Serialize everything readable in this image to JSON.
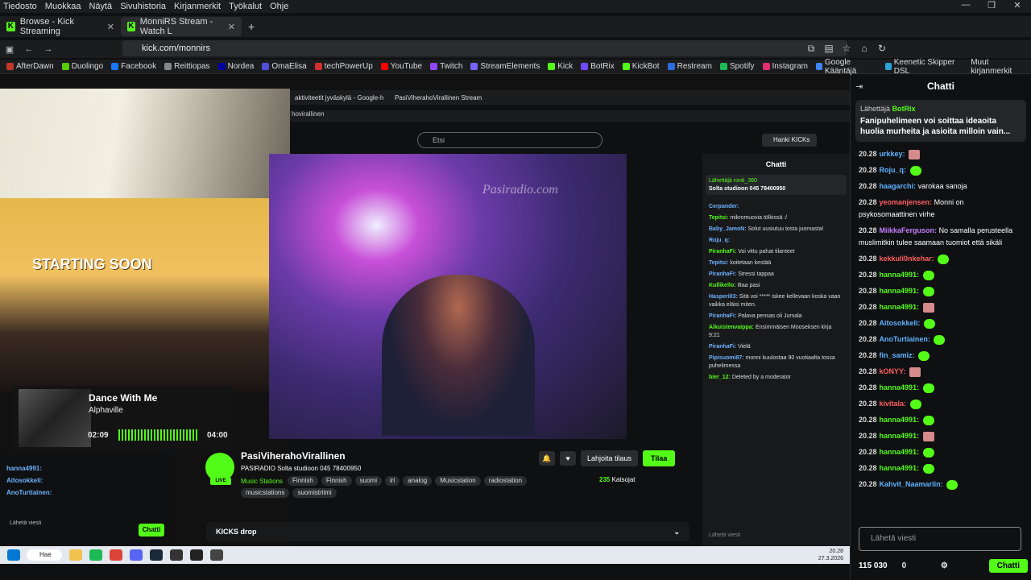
{
  "menubar": [
    "Tiedosto",
    "Muokkaa",
    "Näytä",
    "Sivuhistoria",
    "Kirjanmerkit",
    "Työkalut",
    "Ohje"
  ],
  "tabs": [
    {
      "label": "Browse - Kick Streaming"
    },
    {
      "label": "MonniRS Stream - Watch L"
    }
  ],
  "url": "kick.com/monnirs",
  "bookmarks": [
    {
      "label": "AfterDawn",
      "color": "#c0392b"
    },
    {
      "label": "Duolingo",
      "color": "#58cc02"
    },
    {
      "label": "Facebook",
      "color": "#1877f2"
    },
    {
      "label": "Reittiopas",
      "color": "#888888"
    },
    {
      "label": "Nordea",
      "color": "#0000a0"
    },
    {
      "label": "OmaElisa",
      "color": "#4f4fd9"
    },
    {
      "label": "techPowerUp",
      "color": "#d32f2f"
    },
    {
      "label": "YouTube",
      "color": "#ff0000"
    },
    {
      "label": "Twitch",
      "color": "#9146ff"
    },
    {
      "label": "StreamElements",
      "color": "#7b61ff"
    },
    {
      "label": "Kick",
      "color": "#53fc18"
    },
    {
      "label": "BotRix",
      "color": "#6d4aff"
    },
    {
      "label": "KickBot",
      "color": "#53fc18"
    },
    {
      "label": "Restream",
      "color": "#2d6cdf"
    },
    {
      "label": "Spotify",
      "color": "#1db954"
    },
    {
      "label": "Instagram",
      "color": "#e1306c"
    },
    {
      "label": "Google Kääntäjä",
      "color": "#4285f4"
    },
    {
      "label": "Keenetic Skipper DSL",
      "color": "#2aa3d8"
    }
  ],
  "bookmarks_other": "Muut kirjanmerkit",
  "overlay": {
    "starting_soon": "STARTING SOON"
  },
  "inner": {
    "tab1": "aktiviteetit jyväskylä - Google-h",
    "tab2": "PasiViherahoVirallinen Stream",
    "url": "hovirallinen",
    "search": "Etsi",
    "kicks": "Hanki KICKs",
    "watermark": "Pasiradio.com",
    "chat_title": "Chatti",
    "pin_user": "Lähettäjä  ronti_360",
    "pin_text": "Solta studioon 045 78400950",
    "messages": [
      {
        "user": "Cerpander:",
        "text": ""
      },
      {
        "user": "Tepitsi:",
        "text": "mikromuovia tölkissä :/"
      },
      {
        "user": "Baby_JamoN:",
        "text": "Solut uusiutuu tosta juomasta!"
      },
      {
        "user": "Roju_q:",
        "text": ""
      },
      {
        "user": "PiranhaFi:",
        "text": "Voi vittu pahat tilanteet"
      },
      {
        "user": "Tepitsi:",
        "text": "koitetaan kestää"
      },
      {
        "user": "PiranhaFi:",
        "text": "Stressi tappaa"
      },
      {
        "user": "Kullikello:",
        "text": "Iltaa pasi"
      },
      {
        "user": "Hasperi03:",
        "text": "Sitä voi ***** iskee kellevaan koska vaan vaikka eläisi miten."
      },
      {
        "user": "PiranhaFi:",
        "text": "Palava pensas oli Jumala"
      },
      {
        "user": "Aikuistenvaippa:",
        "text": "Ensimmäisen Mooseksen kirja 9:21"
      },
      {
        "user": "PiranhaFi:",
        "text": "Vielä"
      },
      {
        "user": "Pipisuomi87:",
        "text": "monni kuulostaa 90 vuotiaalta tossa puhelimessa"
      },
      {
        "user": "bier_12:",
        "text": "Deleted by a moderator"
      }
    ],
    "input": "Lähetä viesti"
  },
  "stream": {
    "name": "PasiViherahoVirallinen",
    "title": "PASIRADIO Solta studioon 045 78400950",
    "category": "Music Stations",
    "tags": [
      "Finnish",
      "Finnish",
      "suomi",
      "irl",
      "analog",
      "Musicstation",
      "radiostation",
      "musicstations",
      "suomistriimi"
    ],
    "live": "LIVE",
    "gift": "Lahjoita tilaus",
    "subscribe": "Tilaa",
    "viewers": "235",
    "viewers_label": "Katsojat",
    "kicks_drop": "KICKS drop"
  },
  "music": {
    "song": "Dance With Me",
    "artist": "Alphaville",
    "elapsed": "02:09",
    "total": "04:00"
  },
  "leftchat": {
    "messages": [
      {
        "user": "hanna4991:"
      },
      {
        "user": "Aitosokkeli:"
      },
      {
        "user": "AnoTurtiainen:"
      }
    ],
    "input": "Lähetä viesti",
    "button": "Chatti"
  },
  "chat": {
    "title": "Chatti",
    "pinned_header": "Lähettäjä",
    "pinned_user": "BotRix",
    "pinned_text": "Fanipuhelimeen voi soittaa ideaoita huolia murheita ja asioita milloin vain...",
    "messages": [
      {
        "ts": "20.28",
        "user": "urkkey:",
        "color": "#5fb3ff",
        "text": ""
      },
      {
        "ts": "20.28",
        "user": "Roju_q:",
        "color": "#5fb3ff",
        "text": ""
      },
      {
        "ts": "20.28",
        "user": "haagarchi:",
        "color": "#5fb3ff",
        "text": "varokaa sanoja"
      },
      {
        "ts": "20.28",
        "user": "yeomanjensen:",
        "color": "#ff5f5f",
        "text": "Monni on psykosomaattinen virhe"
      },
      {
        "ts": "20.28",
        "user": "MiikkaFerguson:",
        "color": "#c57dff",
        "text": "No samalla perusteella muslimitkin tulee saamaan tuomiot että sikäli"
      },
      {
        "ts": "20.28",
        "user": "kekkuli0nkehar:",
        "color": "#ff5f5f",
        "text": ""
      },
      {
        "ts": "20.28",
        "user": "hanna4991:",
        "color": "#53fc18",
        "text": ""
      },
      {
        "ts": "20.28",
        "user": "hanna4991:",
        "color": "#53fc18",
        "text": ""
      },
      {
        "ts": "20.28",
        "user": "hanna4991:",
        "color": "#53fc18",
        "text": ""
      },
      {
        "ts": "20.28",
        "user": "Aitosokkeli:",
        "color": "#5fb3ff",
        "text": ""
      },
      {
        "ts": "20.28",
        "user": "AnoTurtiainen:",
        "color": "#5fb3ff",
        "text": ""
      },
      {
        "ts": "20.28",
        "user": "fin_samiz:",
        "color": "#5fb3ff",
        "text": ""
      },
      {
        "ts": "20.28",
        "user": "kONYY:",
        "color": "#ff5f5f",
        "text": ""
      },
      {
        "ts": "20.28",
        "user": "hanna4991:",
        "color": "#53fc18",
        "text": ""
      },
      {
        "ts": "20.28",
        "user": "kivitala:",
        "color": "#ff5f5f",
        "text": ""
      },
      {
        "ts": "20.28",
        "user": "hanna4991:",
        "color": "#53fc18",
        "text": ""
      },
      {
        "ts": "20.28",
        "user": "hanna4991:",
        "color": "#53fc18",
        "text": ""
      },
      {
        "ts": "20.28",
        "user": "hanna4991:",
        "color": "#53fc18",
        "text": ""
      },
      {
        "ts": "20.28",
        "user": "hanna4991:",
        "color": "#53fc18",
        "text": ""
      },
      {
        "ts": "20.28",
        "user": "Kahvit_Naamariin:",
        "color": "#5fb3ff",
        "text": ""
      }
    ],
    "input_placeholder": "Lähetä viesti",
    "points": "115 030",
    "gift_count": "0",
    "send_button": "Chatti"
  },
  "taskbar": {
    "search": "Hae",
    "time": "20.28",
    "date": "27.3.2026"
  }
}
